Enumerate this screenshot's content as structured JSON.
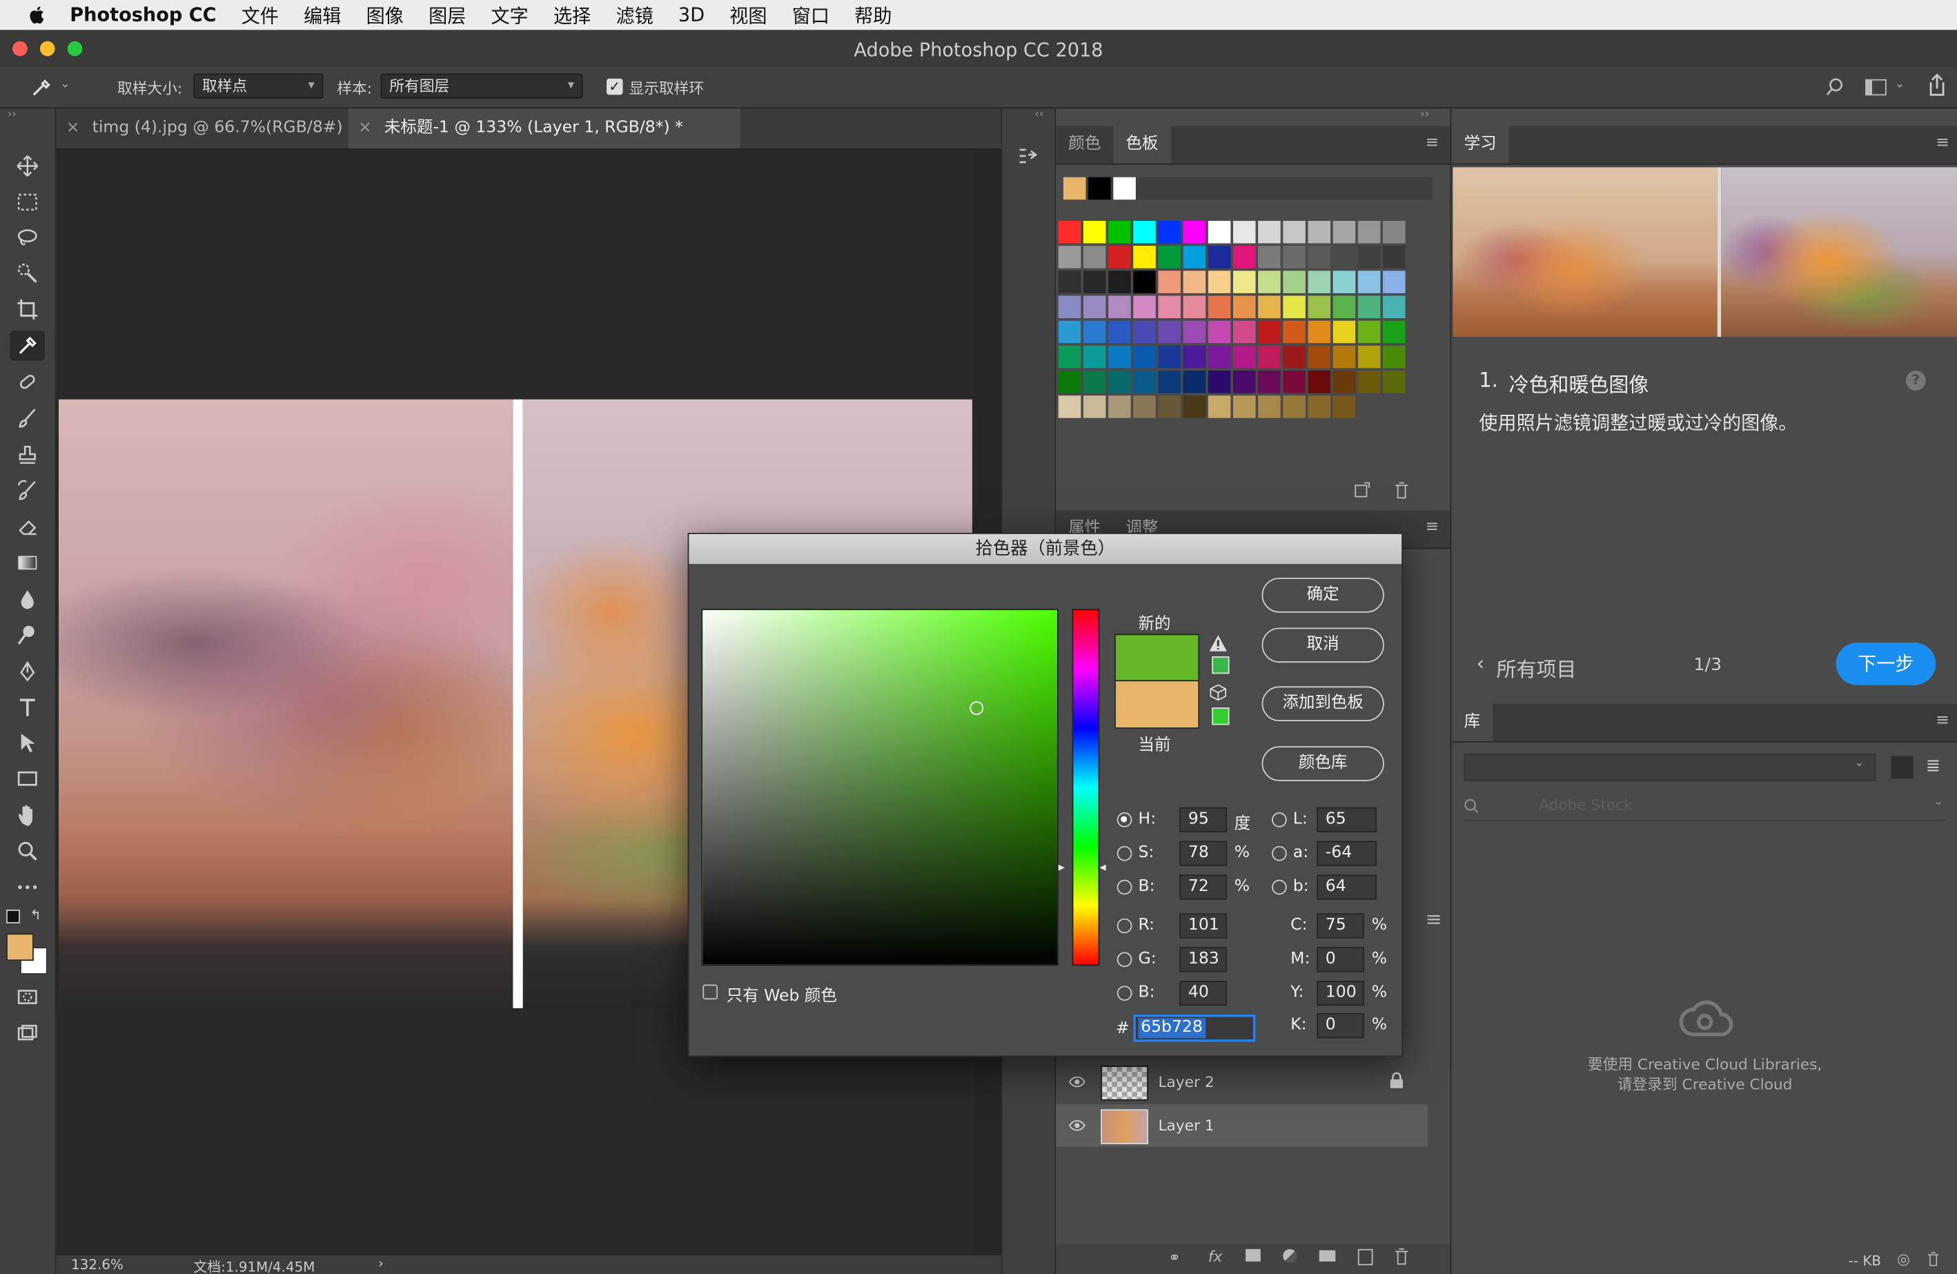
{
  "menubar": {
    "app_name": "Photoshop CC",
    "items": [
      "文件",
      "编辑",
      "图像",
      "图层",
      "文字",
      "选择",
      "滤镜",
      "3D",
      "视图",
      "窗口",
      "帮助"
    ]
  },
  "window": {
    "title": "Adobe Photoshop CC 2018"
  },
  "options": {
    "sample_size_label": "取样大小:",
    "sample_size_value": "取样点",
    "sample_label": "样本:",
    "sample_value": "所有图层",
    "show_ring_label": "显示取样环",
    "show_ring_checked": true
  },
  "doc_tabs": [
    {
      "label": "timg (4).jpg @ 66.7%(RGB/8#)",
      "active": false
    },
    {
      "label": "未标题-1 @ 133% (Layer 1, RGB/8*) *",
      "active": true
    }
  ],
  "status": {
    "zoom": "132.6%",
    "doc_size": "文档:1.91M/4.45M"
  },
  "color_panel": {
    "tabs": [
      "颜色",
      "色板"
    ],
    "active_tab": "色板",
    "recent_swatches": [
      "#e8b66a",
      "#000000",
      "#ffffff"
    ],
    "swatch_rows": [
      [
        "#ff2a2a",
        "#ffff00",
        "#00c000",
        "#00ffff",
        "#0033ff",
        "#ff00ff",
        "#ffffff",
        "#e6e6e6",
        "#d6d6d6",
        "#c6c6c6",
        "#b6b6b6",
        "#a6a6a6",
        "#969696",
        "#868686"
      ],
      [
        "#9a9a9a",
        "#8a8a8a",
        "#d42020",
        "#ffee00",
        "#009a3a",
        "#00a0e0",
        "#1a2a9a",
        "#e0157a",
        "#7a7a7a",
        "#6a6a6a",
        "#5a5a5a",
        "#4a4a4a",
        "#404040",
        "#383838"
      ],
      [
        "#303030",
        "#282828",
        "#1e1e1e",
        "#000000",
        "#ee9a7a",
        "#f2b88a",
        "#f6d08a",
        "#f0e68a",
        "#c2de8a",
        "#a2d28a",
        "#9ad2b2",
        "#8ad2d2",
        "#8ac2e6",
        "#8aaee6"
      ],
      [
        "#8a8ac2",
        "#9a8ac2",
        "#b28ac2",
        "#d28ac2",
        "#e68aaa",
        "#e68a9a",
        "#e6744a",
        "#e6944a",
        "#e6b44a",
        "#e6e64a",
        "#9ac24a",
        "#5ab24a",
        "#4ab27a",
        "#4ab2b2"
      ],
      [
        "#2a9ad2",
        "#2a7ad2",
        "#2a5ac2",
        "#4a4ab2",
        "#6a4ab2",
        "#9a4ab2",
        "#c24ab2",
        "#d24a8a",
        "#c21a1a",
        "#d25a1a",
        "#e28a1a",
        "#e6d21a",
        "#6ab21a",
        "#1aa21a"
      ],
      [
        "#0a9a5a",
        "#0a9a9a",
        "#0a7ac2",
        "#0a5ab2",
        "#1a3a9a",
        "#4a1a9a",
        "#7a1a9a",
        "#b21a8a",
        "#c21a5a",
        "#9a1a1a",
        "#a24a0a",
        "#b27a0a",
        "#b2a20a",
        "#4a8a0a"
      ],
      [
        "#0a7a0a",
        "#0a7a4a",
        "#0a6a6a",
        "#0a5a8a",
        "#0a3a7a",
        "#0a2a6a",
        "#2a0a6a",
        "#4a0a6a",
        "#6a0a5a",
        "#7a0a3a",
        "#6a0a0a",
        "#6a3a0a",
        "#6a5a0a",
        "#5a6a0a"
      ],
      [
        "#d8c8a8",
        "#c8b898",
        "#a89878",
        "#887858",
        "#685838",
        "#483818",
        "#c8a868",
        "#b89858",
        "#a88848",
        "#987838",
        "#886828",
        "#785818"
      ]
    ],
    "sub_tabs": [
      "属性",
      "调整"
    ]
  },
  "layers": [
    {
      "name": "Layer 2",
      "locked": true
    },
    {
      "name": "Layer 1",
      "locked": false
    }
  ],
  "learn": {
    "tab": "学习",
    "step_number": "1.",
    "step_title": "冷色和暖色图像",
    "step_desc": "使用照片滤镜调整过暖或过冷的图像。",
    "all_items": "所有项目",
    "progress": "1/3",
    "next_button": "下一步"
  },
  "library": {
    "tab": "库",
    "search_placeholder": "Adobe Stock",
    "message_line1": "要使用 Creative Cloud Libraries,",
    "message_line2": "请登录到 Creative Cloud",
    "size": "-- KB"
  },
  "picker": {
    "title": "拾色器（前景色）",
    "ok": "确定",
    "cancel": "取消",
    "add_to_swatches": "添加到色板",
    "color_libraries": "颜色库",
    "new_label": "新的",
    "current_label": "当前",
    "new_color": "#65b728",
    "current_color": "#e8b66a",
    "hue_color": "#4cff00",
    "web_only_label": "只有 Web 颜色",
    "web_only_checked": false,
    "fields": {
      "H": {
        "label": "H:",
        "value": "95",
        "unit": "度"
      },
      "S": {
        "label": "S:",
        "value": "78",
        "unit": "%"
      },
      "Bv": {
        "label": "B:",
        "value": "72",
        "unit": "%"
      },
      "R": {
        "label": "R:",
        "value": "101"
      },
      "G": {
        "label": "G:",
        "value": "183"
      },
      "Bc": {
        "label": "B:",
        "value": "40"
      },
      "L": {
        "label": "L:",
        "value": "65"
      },
      "a": {
        "label": "a:",
        "value": "-64"
      },
      "b": {
        "label": "b:",
        "value": "64"
      },
      "C": {
        "label": "C:",
        "value": "75",
        "unit": "%"
      },
      "M": {
        "label": "M:",
        "value": "0",
        "unit": "%"
      },
      "Y": {
        "label": "Y:",
        "value": "100",
        "unit": "%"
      },
      "K": {
        "label": "K:",
        "value": "0",
        "unit": "%"
      }
    },
    "hex_label": "#",
    "hex_value": "65b728"
  },
  "colors": {
    "accent_blue": "#1a8ef0",
    "panel_bg": "#4a4a4a"
  }
}
